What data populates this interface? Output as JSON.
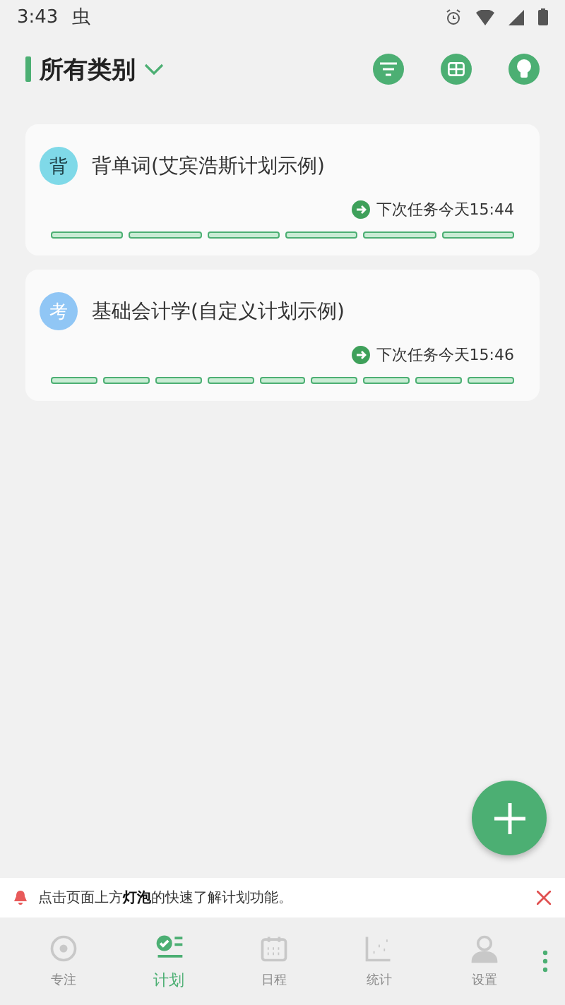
{
  "status_bar": {
    "time": "3:43",
    "app_glyph": "虫"
  },
  "header": {
    "title": "所有类别"
  },
  "plans": [
    {
      "avatar": "背",
      "color": "#7fd9e8",
      "title": "背单词(艾宾浩斯计划示例)",
      "next": "下次任务今天15:44",
      "segments": [
        {
          "done": false
        },
        {
          "done": false
        },
        {
          "done": false
        },
        {
          "done": false
        },
        {
          "done": false
        },
        {
          "done": false
        }
      ]
    },
    {
      "avatar": "考",
      "color": "#90c6f5",
      "title": "基础会计学(自定义计划示例)",
      "next": "下次任务今天15:46",
      "segments": [
        {
          "done": false
        },
        {
          "done": false
        },
        {
          "done": false
        },
        {
          "done": false
        },
        {
          "done": false
        },
        {
          "done": false
        },
        {
          "done": false
        },
        {
          "done": false
        },
        {
          "done": false
        }
      ]
    }
  ],
  "notice": {
    "text": "点击页面上方**灯泡**的快速了解计划功能。"
  },
  "tabs": [
    {
      "kind": "focus",
      "label": "专注",
      "selected": false
    },
    {
      "kind": "plan",
      "label": "计划",
      "selected": true
    },
    {
      "kind": "calendar",
      "label": "日程",
      "selected": false
    },
    {
      "kind": "stats",
      "label": "统计",
      "selected": false
    },
    {
      "kind": "profile",
      "label": "设置",
      "selected": false
    }
  ]
}
